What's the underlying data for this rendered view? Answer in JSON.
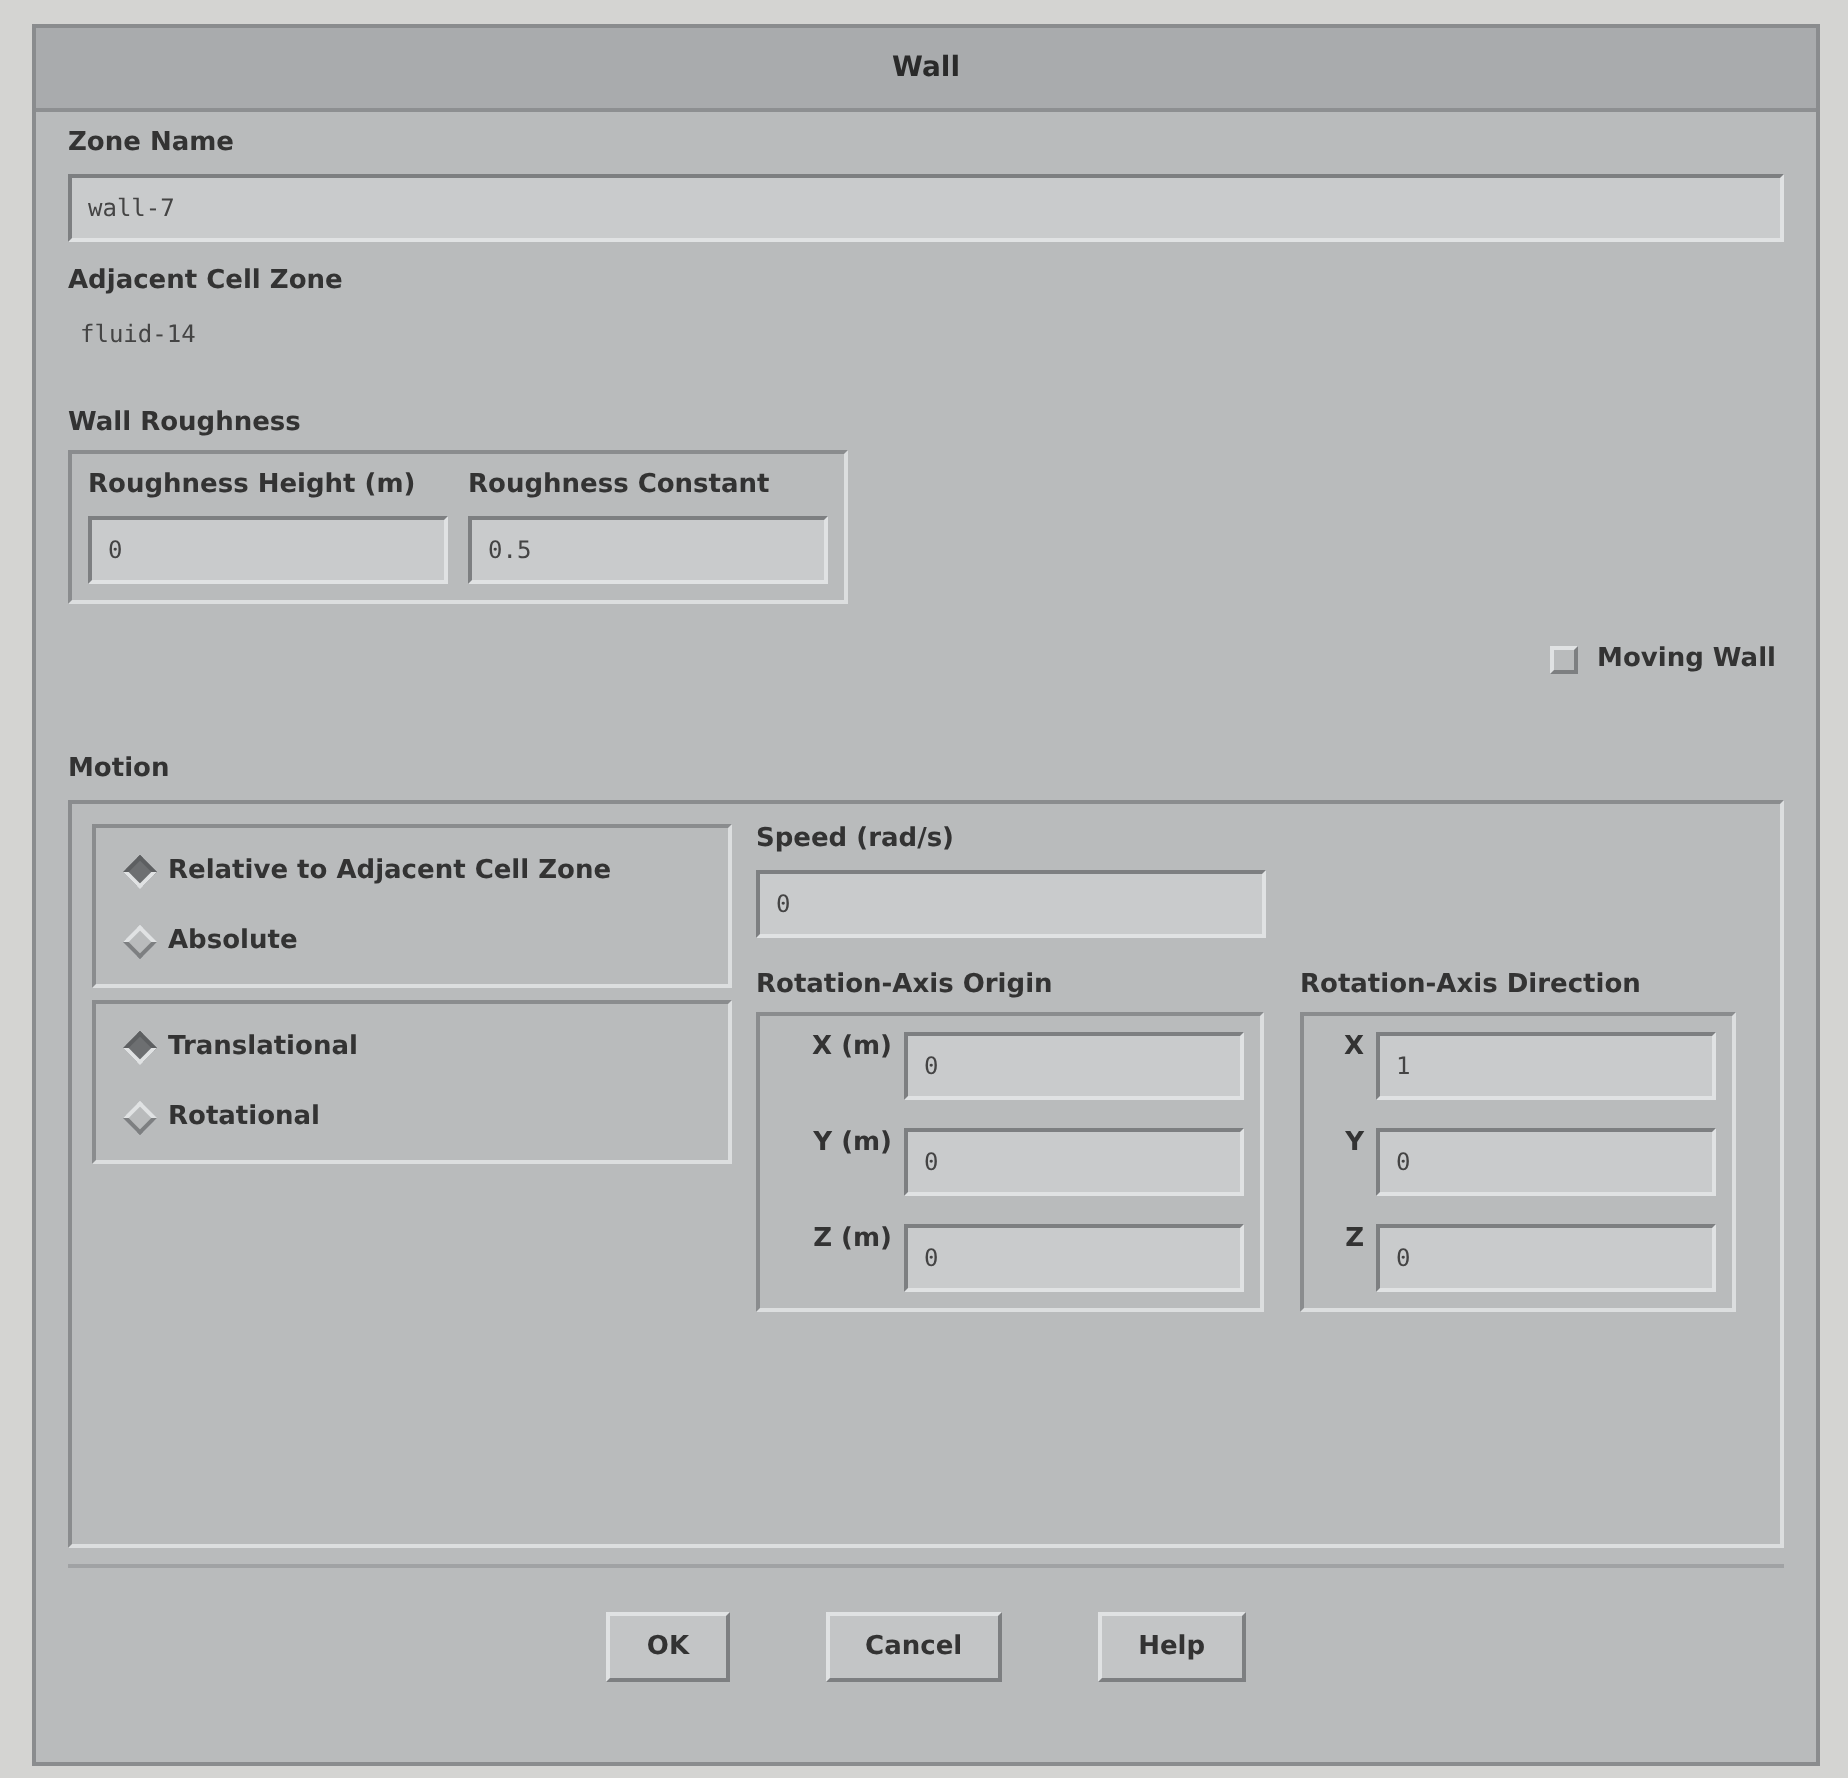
{
  "window": {
    "title": "Wall"
  },
  "zone_name": {
    "label": "Zone Name",
    "value": "wall-7"
  },
  "adjacent_cell_zone": {
    "label": "Adjacent Cell Zone",
    "value": "fluid-14"
  },
  "wall_roughness": {
    "label": "Wall Roughness",
    "fields": [
      {
        "label": "Roughness Height (m)",
        "value": "0"
      },
      {
        "label": "Roughness Constant",
        "value": "0.5"
      }
    ]
  },
  "moving_wall": {
    "label": "Moving Wall",
    "checked": false
  },
  "motion": {
    "label": "Motion",
    "reference": [
      {
        "label": "Relative to Adjacent Cell Zone",
        "selected": true
      },
      {
        "label": "Absolute",
        "selected": false
      }
    ],
    "type": [
      {
        "label": "Translational",
        "selected": true
      },
      {
        "label": "Rotational",
        "selected": false
      }
    ],
    "speed": {
      "label": "Speed (rad/s)",
      "value": "0"
    },
    "origin": {
      "label": "Rotation-Axis Origin",
      "fields": [
        {
          "label": "X (m)",
          "value": "0"
        },
        {
          "label": "Y (m)",
          "value": "0"
        },
        {
          "label": "Z (m)",
          "value": "0"
        }
      ]
    },
    "direction": {
      "label": "Rotation-Axis Direction",
      "fields": [
        {
          "label": "X",
          "value": "1"
        },
        {
          "label": "Y",
          "value": "0"
        },
        {
          "label": "Z",
          "value": "0"
        }
      ]
    }
  },
  "buttons": [
    "OK",
    "Cancel",
    "Help"
  ]
}
